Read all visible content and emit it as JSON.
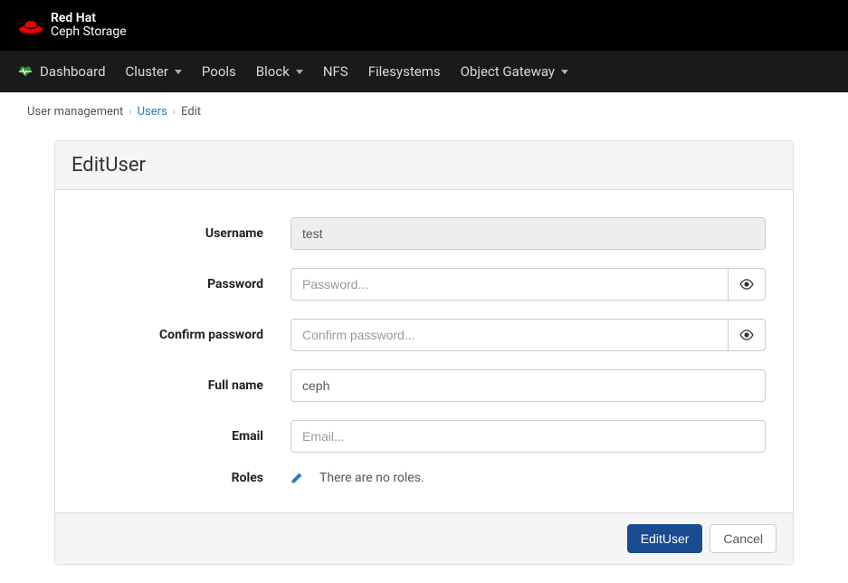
{
  "brand": {
    "line1": "Red Hat",
    "line2": "Ceph Storage"
  },
  "nav": {
    "items": [
      {
        "label": "Dashboard",
        "icon": "heartbeat"
      },
      {
        "label": "Cluster",
        "caret": true
      },
      {
        "label": "Pools"
      },
      {
        "label": "Block",
        "caret": true
      },
      {
        "label": "NFS"
      },
      {
        "label": "Filesystems"
      },
      {
        "label": "Object Gateway",
        "caret": true
      }
    ]
  },
  "breadcrumb": {
    "item0": "User management",
    "item1": "Users",
    "item2": "Edit"
  },
  "panel": {
    "title": "EditUser"
  },
  "form": {
    "username": {
      "label": "Username",
      "value": "test"
    },
    "password": {
      "label": "Password",
      "placeholder": "Password..."
    },
    "confirm": {
      "label": "Confirm password",
      "placeholder": "Confirm password..."
    },
    "fullname": {
      "label": "Full name",
      "value": "ceph"
    },
    "email": {
      "label": "Email",
      "placeholder": "Email..."
    },
    "roles": {
      "label": "Roles",
      "empty": "There are no roles."
    }
  },
  "buttons": {
    "submit": "EditUser",
    "cancel": "Cancel"
  }
}
